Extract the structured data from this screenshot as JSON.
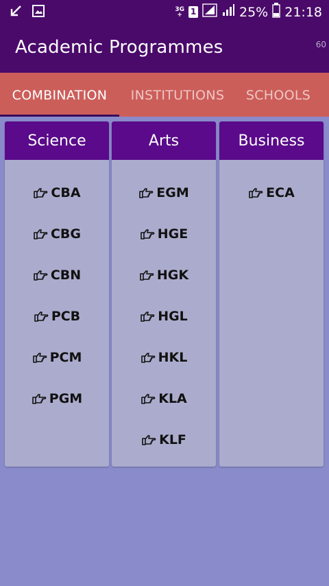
{
  "status_bar": {
    "network_top": "3G",
    "network_bottom": "+",
    "sim": "1",
    "battery": "25%",
    "time": "21:18"
  },
  "app_bar": {
    "title": "Academic Programmes",
    "corner_badge": "60"
  },
  "tabs": [
    {
      "label": "COMBINATION",
      "selected": true
    },
    {
      "label": "INSTITUTIONS",
      "selected": false
    },
    {
      "label": "SCHOOLS",
      "selected": false
    }
  ],
  "columns": [
    {
      "title": "Science",
      "items": [
        "CBA",
        "CBG",
        "CBN",
        "PCB",
        "PCM",
        "PGM"
      ]
    },
    {
      "title": "Arts",
      "items": [
        "EGM",
        "HGE",
        "HGK",
        "HGL",
        "HKL",
        "KLA",
        "KLF"
      ]
    },
    {
      "title": "Business",
      "items": [
        "ECA"
      ]
    }
  ],
  "colors": {
    "app_bar": "#4a0a6a",
    "tab_bar": "#cc5e5a",
    "column_header": "#5a0a8a",
    "column_body": "#abaccd",
    "background": "#8a8bcb"
  },
  "icons": {
    "item": "pointing-hand-icon"
  }
}
